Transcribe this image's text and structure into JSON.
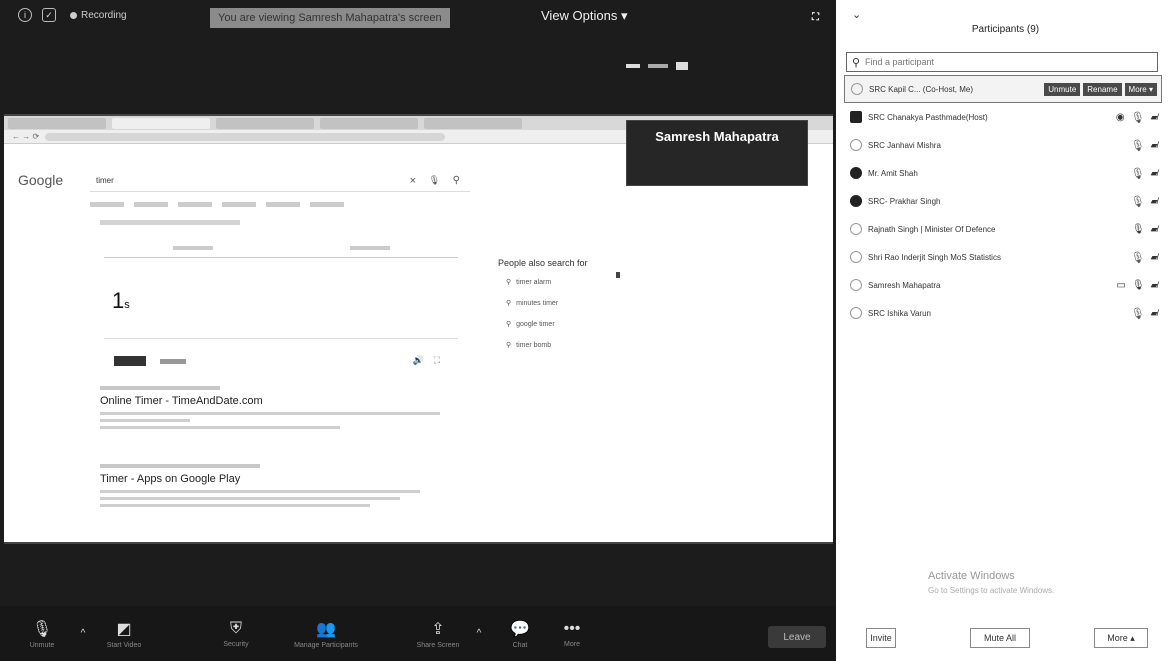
{
  "meeting": {
    "recording_label": "Recording",
    "viewing_banner": "You are viewing Samresh Mahapatra's screen",
    "view_options": "View Options ▾",
    "speaker_name": "Samresh Mahapatra",
    "shared_screen": {
      "google_logo": "Google",
      "search_query": "timer",
      "timer_value": "1",
      "timer_unit": "s",
      "people_also_search_title": "People also search for",
      "people_also_search": [
        "timer alarm",
        "minutes timer",
        "google timer",
        "timer bomb"
      ],
      "results": [
        {
          "title": "Online Timer - TimeAndDate.com"
        },
        {
          "title": "Timer - Apps on Google Play"
        }
      ]
    },
    "toolbar": {
      "unmute": "Unmute",
      "start_video": "Start Video",
      "security": "Security",
      "manage_participants": "Manage Participants",
      "share_screen": "Share Screen",
      "chat": "Chat",
      "more": "More",
      "leave": "Leave"
    }
  },
  "panel": {
    "title": "Participants (9)",
    "search_placeholder": "Find a participant",
    "participants": [
      {
        "name": "SRC Kapil C... (Co-Host, Me)"
      },
      {
        "name": "SRC Chanakya Pasthmade(Host)"
      },
      {
        "name": "SRC Janhavi Mishra"
      },
      {
        "name": "Mr. Amit Shah"
      },
      {
        "name": "SRC- Prakhar Singh"
      },
      {
        "name": "Rajnath Singh | Minister Of Defence"
      },
      {
        "name": "Shri Rao Inderjit Singh MoS Statistics"
      },
      {
        "name": "Samresh Mahapatra"
      },
      {
        "name": "SRC Ishika Varun"
      }
    ],
    "row_actions": {
      "unmute": "Unmute",
      "rename": "Rename",
      "more": "More ▾"
    },
    "footer": {
      "invite": "Invite",
      "mute_all": "Mute All",
      "more": "More ▴"
    },
    "activate_windows": {
      "title": "Activate Windows",
      "subtitle": "Go to Settings to activate Windows."
    }
  }
}
